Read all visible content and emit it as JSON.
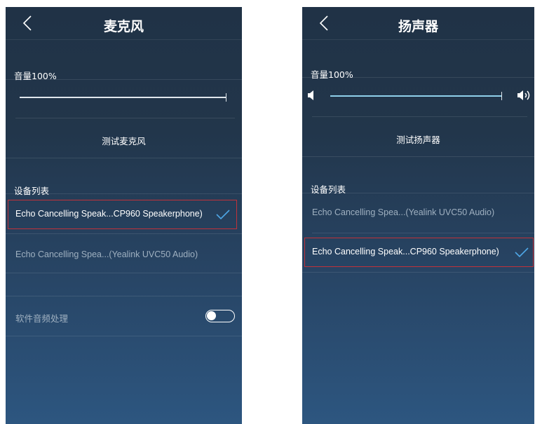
{
  "microphone_panel": {
    "title": "麦克风",
    "volume_label": "音量100%",
    "volume_level": 1.0,
    "test_button": "测试麦克风",
    "device_list_label": "设备列表",
    "devices": [
      {
        "name": "Echo Cancelling Speak...CP960 Speakerphone)",
        "selected": true
      },
      {
        "name": "Echo Cancelling Spea...(Yealink UVC50 Audio)",
        "selected": false
      }
    ],
    "software_processing_label": "软件音频处理",
    "software_processing_enabled": false
  },
  "speaker_panel": {
    "title": "扬声器",
    "volume_label": "音量100%",
    "volume_level": 1.0,
    "test_button": "测试扬声器",
    "device_list_label": "设备列表",
    "devices": [
      {
        "name": "Echo Cancelling Spea...(Yealink UVC50 Audio)",
        "selected": false
      },
      {
        "name": "Echo Cancelling Speak...CP960 Speakerphone)",
        "selected": true
      }
    ]
  },
  "colors": {
    "accent": "#4ea6e6",
    "highlight_border": "#c0323a",
    "background_top": "#203246",
    "background_bottom": "#2d5680"
  },
  "icons": {
    "back": "chevron-left-icon",
    "check": "checkmark-icon",
    "mute": "speaker-mute-icon",
    "volume": "speaker-volume-icon"
  }
}
